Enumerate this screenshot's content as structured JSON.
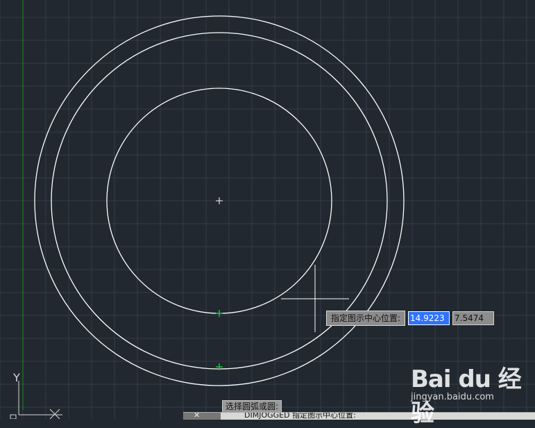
{
  "dynamic_input": {
    "prompt": "指定图示中心位置:",
    "x_value": "14.9223",
    "y_value": "7.5474"
  },
  "command": {
    "prompt": "选择圆弧或圆:",
    "history": "DIMJOGGED 指定图示中心位置:"
  },
  "ucs": {
    "y_label": "Y",
    "x_label": "X"
  },
  "watermark": {
    "brand": "Bai du 经验",
    "url": "jingyan.baidu.com"
  },
  "colors": {
    "background": "#212830",
    "grid": "#343c47",
    "geometry": "#ffffff",
    "snap_marker": "#19c23c",
    "y_axis": "#1e8c1e",
    "active_input": "#2f72ff"
  }
}
